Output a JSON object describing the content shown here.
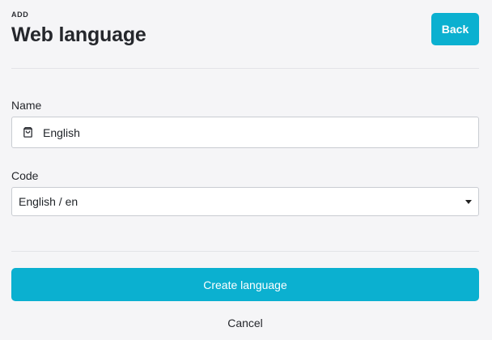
{
  "header": {
    "eyebrow": "ADD",
    "title": "Web language",
    "back_label": "Back"
  },
  "form": {
    "name": {
      "label": "Name",
      "value": "English",
      "icon": "shopping-bag-icon"
    },
    "code": {
      "label": "Code",
      "selected": "English / en",
      "icon": "caret-down-icon"
    }
  },
  "actions": {
    "create_label": "Create language",
    "cancel_label": "Cancel"
  },
  "colors": {
    "accent": "#0bb0d0",
    "background": "#f5f5f7",
    "divider": "#e3e4e8",
    "input_border": "#c9ccd2"
  }
}
